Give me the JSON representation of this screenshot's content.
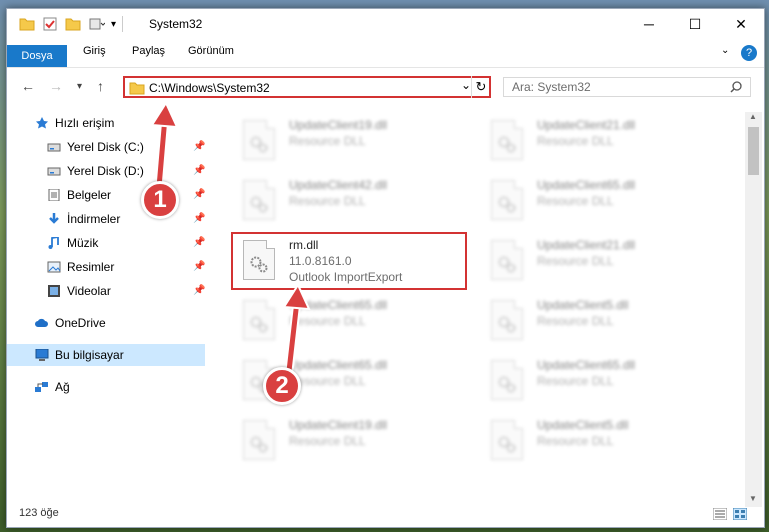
{
  "window": {
    "title": "System32",
    "minimize": "─",
    "maximize": "☐",
    "close": "✕"
  },
  "ribbon": {
    "tabs": [
      "Dosya",
      "Giriş",
      "Paylaş",
      "Görünüm"
    ],
    "help": "?"
  },
  "nav": {
    "back": "←",
    "forward": "→",
    "recent": "▾",
    "up": "↑",
    "address": "C:\\Windows\\System32",
    "address_dropdown": "⌄",
    "refresh": "↻",
    "search_placeholder": "Ara: System32"
  },
  "sidebar": {
    "items": [
      {
        "label": "Hızlı erişim",
        "icon": "star-icon"
      },
      {
        "label": "Yerel Disk (C:)",
        "icon": "drive-icon",
        "pinned": true
      },
      {
        "label": "Yerel Disk (D:)",
        "icon": "drive-icon",
        "pinned": true
      },
      {
        "label": "Belgeler",
        "icon": "documents-icon",
        "pinned": true
      },
      {
        "label": "İndirmeler",
        "icon": "downloads-icon",
        "pinned": true
      },
      {
        "label": "Müzik",
        "icon": "music-icon",
        "pinned": true
      },
      {
        "label": "Resimler",
        "icon": "pictures-icon",
        "pinned": true
      },
      {
        "label": "Videolar",
        "icon": "videos-icon",
        "pinned": true
      },
      {
        "label": "OneDrive",
        "icon": "cloud-icon"
      },
      {
        "label": "Bu bilgisayar",
        "icon": "computer-icon",
        "selected": true
      },
      {
        "label": "Ağ",
        "icon": "network-icon"
      }
    ]
  },
  "files": {
    "left": [
      {
        "name": "UpdateClient19.dll",
        "desc": "Resource DLL"
      },
      {
        "name": "UpdateClient42.dll",
        "desc": "Resource DLL"
      },
      {
        "name": "rm.dll",
        "version": "11.0.8161.0",
        "desc": "Outlook ImportExport"
      },
      {
        "name": "UpdateClient65.dll",
        "desc": "Resource DLL"
      },
      {
        "name": "UpdateClient65.dll",
        "desc": "Resource DLL"
      },
      {
        "name": "UpdateClient19.dll",
        "desc": "Resource DLL"
      }
    ],
    "right": [
      {
        "name": "UpdateClient21.dll",
        "desc": "Resource DLL"
      },
      {
        "name": "UpdateClient65.dll",
        "desc": "Resource DLL"
      },
      {
        "name": "UpdateClient21.dll",
        "desc": "Resource DLL"
      },
      {
        "name": "UpdateClient5.dll",
        "desc": "Resource DLL"
      },
      {
        "name": "UpdateClient65.dll",
        "desc": "Resource DLL"
      },
      {
        "name": "UpdateClient5.dll",
        "desc": "Resource DLL"
      }
    ]
  },
  "status": {
    "count": "123 öğe"
  },
  "annotations": {
    "step1": "1",
    "step2": "2"
  },
  "colors": {
    "accent": "#1979ca",
    "highlight": "#d33232",
    "selected": "#cce8ff"
  }
}
